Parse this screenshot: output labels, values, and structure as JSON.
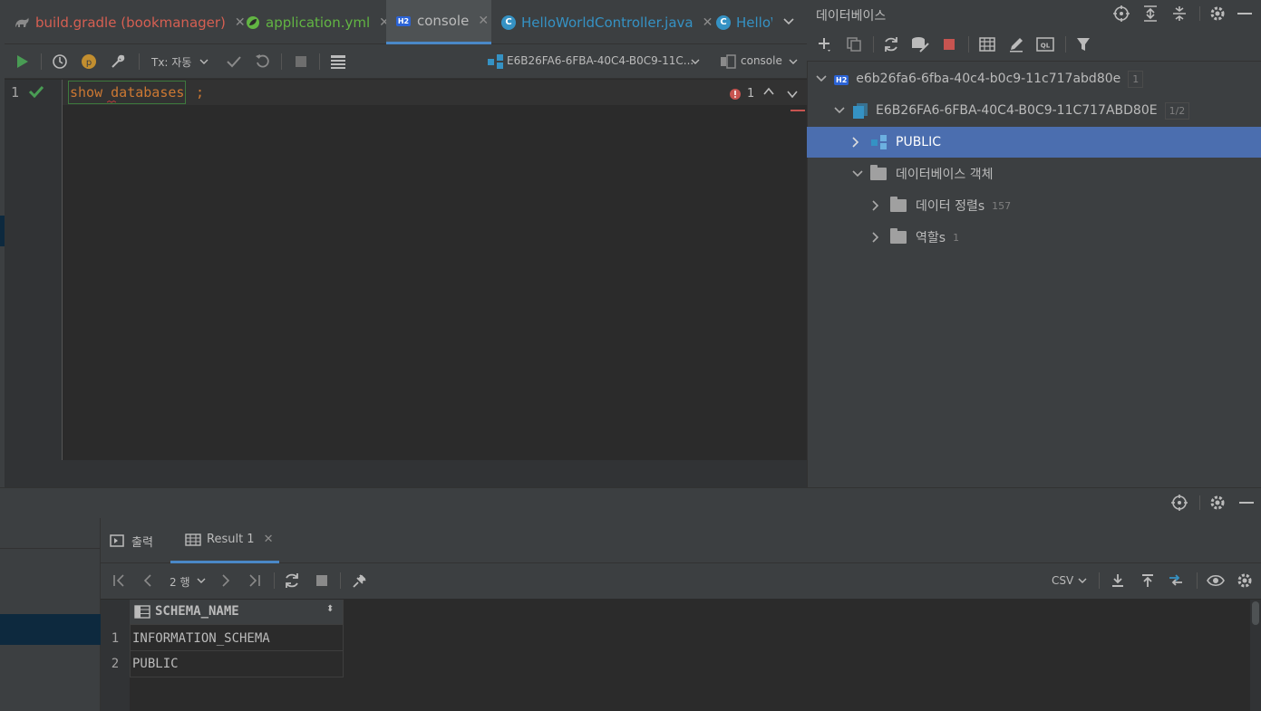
{
  "editor_tabs": [
    {
      "label": "build.gradle (bookmanager)",
      "color": "#d65f52"
    },
    {
      "label": "application.yml",
      "color": "#62b543"
    },
    {
      "label": "console",
      "color": "#bbbbbb"
    },
    {
      "label": "HelloWorldController.java",
      "color": "#3592c4"
    },
    {
      "label": "HelloW",
      "color": "#3592c4"
    }
  ],
  "toolbar": {
    "tx_label": "Tx: 자동",
    "datasource_label": "E6B26FA6-6FBA-40C4-B0C9-11C...",
    "session_label": "console"
  },
  "editor": {
    "line_number": "1",
    "code_keyword": "show databases",
    "code_semicolon": ";",
    "error_count": "1"
  },
  "db_panel": {
    "title": "데이터베이스",
    "tree": [
      {
        "label": "e6b26fa6-6fba-40c4-b0c9-11c717abd80e",
        "count": "1"
      },
      {
        "label": "E6B26FA6-6FBA-40C4-B0C9-11C717ABD80E",
        "count": "1/2"
      },
      {
        "label": "PUBLIC"
      },
      {
        "label": "데이터베이스 객체"
      },
      {
        "label": "데이터 정렬s",
        "count": "157"
      },
      {
        "label": "역할s",
        "count": "1"
      }
    ]
  },
  "results": {
    "output_tab": "출력",
    "result_tab": "Result 1",
    "rows_label": "2 행",
    "export_format": "CSV",
    "column_header": "SCHEMA_NAME",
    "rows": [
      {
        "num": "1",
        "value": "INFORMATION_SCHEMA"
      },
      {
        "num": "2",
        "value": "PUBLIC"
      }
    ]
  },
  "colors": {
    "accent": "#4a88c7",
    "selection": "#4b6eaf",
    "run_green": "#499c54",
    "stop_red": "#c75450"
  }
}
